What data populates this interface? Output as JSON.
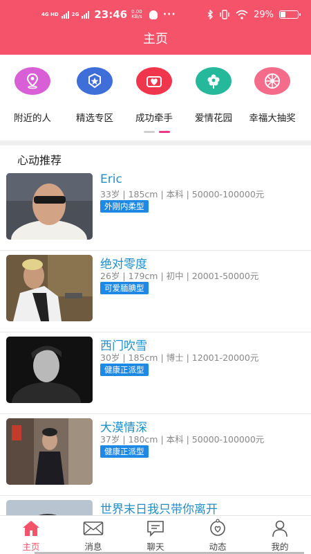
{
  "status_bar": {
    "network_1": "4G HD",
    "network_2": "2G",
    "time": "23:46",
    "speed_value": "0.00",
    "speed_unit": "KB/s",
    "battery": "29%"
  },
  "header": {
    "title": "主页"
  },
  "categories": [
    {
      "label": "附近的人",
      "icon": "location-pin-icon",
      "color": "#d95fd6"
    },
    {
      "label": "精选专区",
      "icon": "star-badge-icon",
      "color": "#3e6fd8"
    },
    {
      "label": "成功牵手",
      "icon": "heart-icon",
      "color": "#f0364c"
    },
    {
      "label": "爱情花园",
      "icon": "flower-icon",
      "color": "#26b89a"
    },
    {
      "label": "幸福大抽奖",
      "icon": "wheel-icon",
      "color": "#f56b8a"
    }
  ],
  "section": {
    "title": "心动推荐"
  },
  "users": [
    {
      "name": "Eric",
      "info": "33岁 | 185cm | 本科 | 50000-100000元",
      "tag": "外刚内柔型"
    },
    {
      "name": "绝对零度",
      "info": "26岁 | 179cm | 初中 | 20001-50000元",
      "tag": "可爱腼腆型"
    },
    {
      "name": "西门吹雪",
      "info": "30岁 | 185cm | 博士 | 12001-20000元",
      "tag": "健康正派型"
    },
    {
      "name": "大漠情深",
      "info": "37岁 | 180cm | 本科 | 50000-100000元",
      "tag": "健康正派型"
    },
    {
      "name": "世界末日我只带你离开",
      "info": "",
      "tag": ""
    }
  ],
  "bottom_nav": [
    {
      "label": "主页",
      "icon": "home-icon",
      "active": true
    },
    {
      "label": "消息",
      "icon": "envelope-icon",
      "active": false
    },
    {
      "label": "聊天",
      "icon": "chat-icon",
      "active": false
    },
    {
      "label": "动态",
      "icon": "moments-icon",
      "active": false
    },
    {
      "label": "我的",
      "icon": "person-icon",
      "active": false
    }
  ],
  "colors": {
    "brand": "#f4536a",
    "link": "#1f8fca",
    "tag": "#1e88e5",
    "indicator": "#e83a87"
  }
}
